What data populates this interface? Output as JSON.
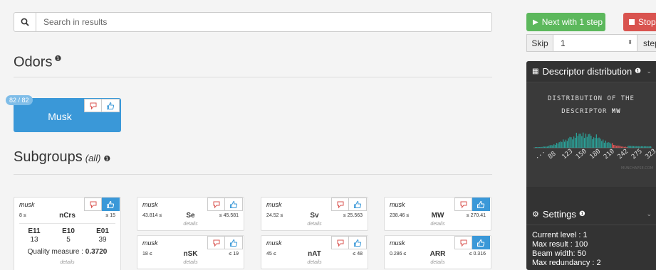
{
  "search": {
    "placeholder": "Search in results"
  },
  "odors": {
    "title": "Odors",
    "count": "82 / 82",
    "card": {
      "name": "Musk"
    }
  },
  "subgroups": {
    "title": "Subgroups",
    "filter": "(all)",
    "cards": [
      {
        "odor": "musk",
        "lo": "8 ≤",
        "name": "nCrs",
        "hi": "≤ 15",
        "liked": true,
        "stats": [
          {
            "label": "E11",
            "value": "13"
          },
          {
            "label": "E10",
            "value": "5"
          },
          {
            "label": "E01",
            "value": "39"
          }
        ],
        "quality_label": "Quality measure : ",
        "quality_value": "0.3720",
        "details": "details"
      },
      {
        "odor": "musk",
        "lo": "43.814 ≤",
        "name": "Se",
        "hi": "≤ 45.581",
        "liked": false,
        "details": "details"
      },
      {
        "odor": "musk",
        "lo": "24.52 ≤",
        "name": "Sv",
        "hi": "≤ 25.563",
        "liked": false,
        "details": "details"
      },
      {
        "odor": "musk",
        "lo": "238.46 ≤",
        "name": "MW",
        "hi": "≤ 270.41",
        "liked": true,
        "details": "details"
      },
      {
        "odor": "musk",
        "lo": "18 ≤",
        "name": "nSK",
        "hi": "≤ 19",
        "liked": false,
        "details": "details"
      },
      {
        "odor": "musk",
        "lo": "45 ≤",
        "name": "nAT",
        "hi": "≤ 48",
        "liked": false,
        "details": "details"
      },
      {
        "odor": "musk",
        "lo": "0.286 ≤",
        "name": "ARR",
        "hi": "≤ 0.316",
        "liked": true,
        "details": "details"
      }
    ]
  },
  "controls": {
    "next_label": "Next with 1 step",
    "stop_label": "Stop",
    "skip_label": "Skip",
    "skip_value": "1",
    "step_unit": "step"
  },
  "distribution": {
    "title": "Descriptor distribution",
    "caption_line1": "DISTRIBUTION OF THE",
    "caption_line2_prefix": "DESCRIPTOR ",
    "caption_descriptor": "MW",
    "ticks": [
      "...",
      "88",
      "123",
      "150",
      "180",
      "210",
      "242",
      "275",
      "323"
    ],
    "credit": "MUNCHAPSE.COM",
    "highlight_color": "#e05555",
    "bar_color": "#2aa198"
  },
  "settings": {
    "title": "Settings",
    "lines": [
      "Current level : 1",
      "Max result : 100",
      "Beam width: 50",
      "Max redundancy : 2"
    ]
  },
  "colors": {
    "primary": "#3a98d8",
    "success": "#5cb85c",
    "danger": "#d9534f"
  }
}
